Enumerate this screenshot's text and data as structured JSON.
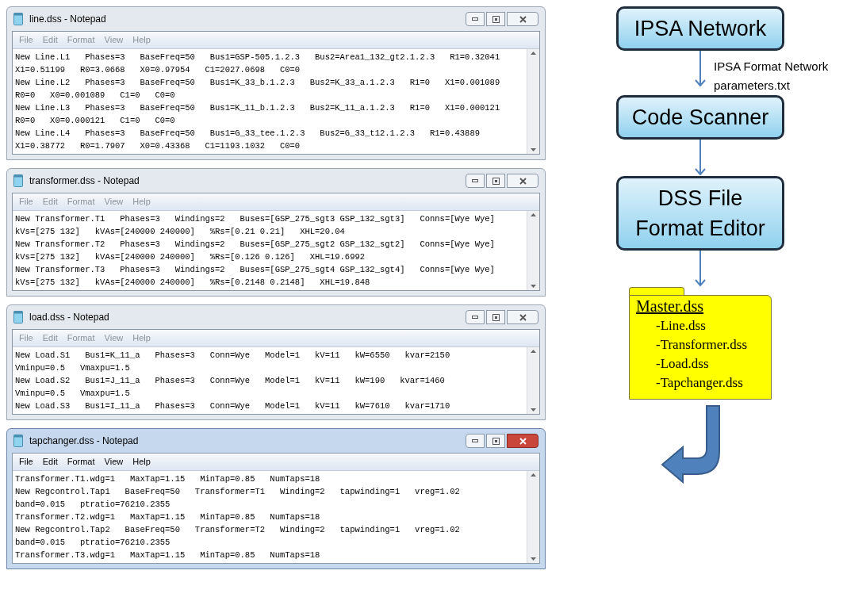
{
  "windows": [
    {
      "title": "line.dss - Notepad",
      "active": false,
      "menu": [
        "File",
        "Edit",
        "Format",
        "View",
        "Help"
      ],
      "lines": [
        "New Line.L1   Phases=3   BaseFreq=50   Bus1=GSP-505.1.2.3   Bus2=Area1_132_gt2.1.2.3   R1=0.32041",
        "X1=0.51199   R0=3.0668   X0=0.97954   C1=2027.0698   C0=0",
        "New Line.L2   Phases=3   BaseFreq=50   Bus1=K_33_b.1.2.3   Bus2=K_33_a.1.2.3   R1=0   X1=0.001089",
        "R0=0   X0=0.001089   C1=0   C0=0",
        "New Line.L3   Phases=3   BaseFreq=50   Bus1=K_11_b.1.2.3   Bus2=K_11_a.1.2.3   R1=0   X1=0.000121",
        "R0=0   X0=0.000121   C1=0   C0=0",
        "New Line.L4   Phases=3   BaseFreq=50   Bus1=G_33_tee.1.2.3   Bus2=G_33_t12.1.2.3   R1=0.43889",
        "X1=0.38772   R0=1.7907   X0=0.43368   C1=1193.1032   C0=0"
      ]
    },
    {
      "title": "transformer.dss - Notepad",
      "active": false,
      "menu": [
        "File",
        "Edit",
        "Format",
        "View",
        "Help"
      ],
      "lines": [
        "New Transformer.T1   Phases=3   Windings=2   Buses=[GSP_275_sgt3 GSP_132_sgt3]   Conns=[Wye Wye]",
        "kVs=[275 132]   kVAs=[240000 240000]   %Rs=[0.21 0.21]   XHL=20.04",
        "New Transformer.T2   Phases=3   Windings=2   Buses=[GSP_275_sgt2 GSP_132_sgt2]   Conns=[Wye Wye]",
        "kVs=[275 132]   kVAs=[240000 240000]   %Rs=[0.126 0.126]   XHL=19.6992",
        "New Transformer.T3   Phases=3   Windings=2   Buses=[GSP_275_sgt4 GSP_132_sgt4]   Conns=[Wye Wye]",
        "kVs=[275 132]   kVAs=[240000 240000]   %Rs=[0.2148 0.2148]   XHL=19.848"
      ]
    },
    {
      "title": "load.dss - Notepad",
      "active": false,
      "menu": [
        "File",
        "Edit",
        "Format",
        "View",
        "Help"
      ],
      "lines": [
        "New Load.S1   Bus1=K_11_a   Phases=3   Conn=Wye   Model=1   kV=11   kW=6550   kvar=2150",
        "Vminpu=0.5   Vmaxpu=1.5",
        "New Load.S2   Bus1=J_11_a   Phases=3   Conn=Wye   Model=1   kV=11   kW=190   kvar=1460",
        "Vminpu=0.5   Vmaxpu=1.5",
        "New Load.S3   Bus1=I_11_a   Phases=3   Conn=Wye   Model=1   kV=11   kW=7610   kvar=1710"
      ]
    },
    {
      "title": "tapchanger.dss - Notepad",
      "active": true,
      "menu": [
        "File",
        "Edit",
        "Format",
        "View",
        "Help"
      ],
      "lines": [
        "Transformer.T1.wdg=1   MaxTap=1.15   MinTap=0.85   NumTaps=18",
        "New Regcontrol.Tap1   BaseFreq=50   Transformer=T1   Winding=2   tapwinding=1   vreg=1.02",
        "band=0.015   ptratio=76210.2355",
        "Transformer.T2.wdg=1   MaxTap=1.15   MinTap=0.85   NumTaps=18",
        "New Regcontrol.Tap2   BaseFreq=50   Transformer=T2   Winding=2   tapwinding=1   vreg=1.02",
        "band=0.015   ptratio=76210.2355",
        "Transformer.T3.wdg=1   MaxTap=1.15   MinTap=0.85   NumTaps=18"
      ]
    }
  ],
  "flowchart": [
    {
      "kind": "box",
      "lines": [
        "IPSA Network"
      ]
    },
    {
      "kind": "arrow",
      "lines": [
        "IPSA Format Network",
        "parameters.txt"
      ]
    },
    {
      "kind": "box",
      "lines": [
        "Code Scanner"
      ]
    },
    {
      "kind": "arrow"
    },
    {
      "kind": "box",
      "lines": [
        "DSS File",
        "Format Editor"
      ]
    },
    {
      "kind": "arrow"
    },
    {
      "kind": "folder",
      "title": "Master.dss",
      "items": [
        "-Line.dss",
        "-Transformer.dss",
        "-Load.dss",
        "-Tapchanger.dss"
      ]
    },
    {
      "kind": "bent-arrow"
    }
  ]
}
